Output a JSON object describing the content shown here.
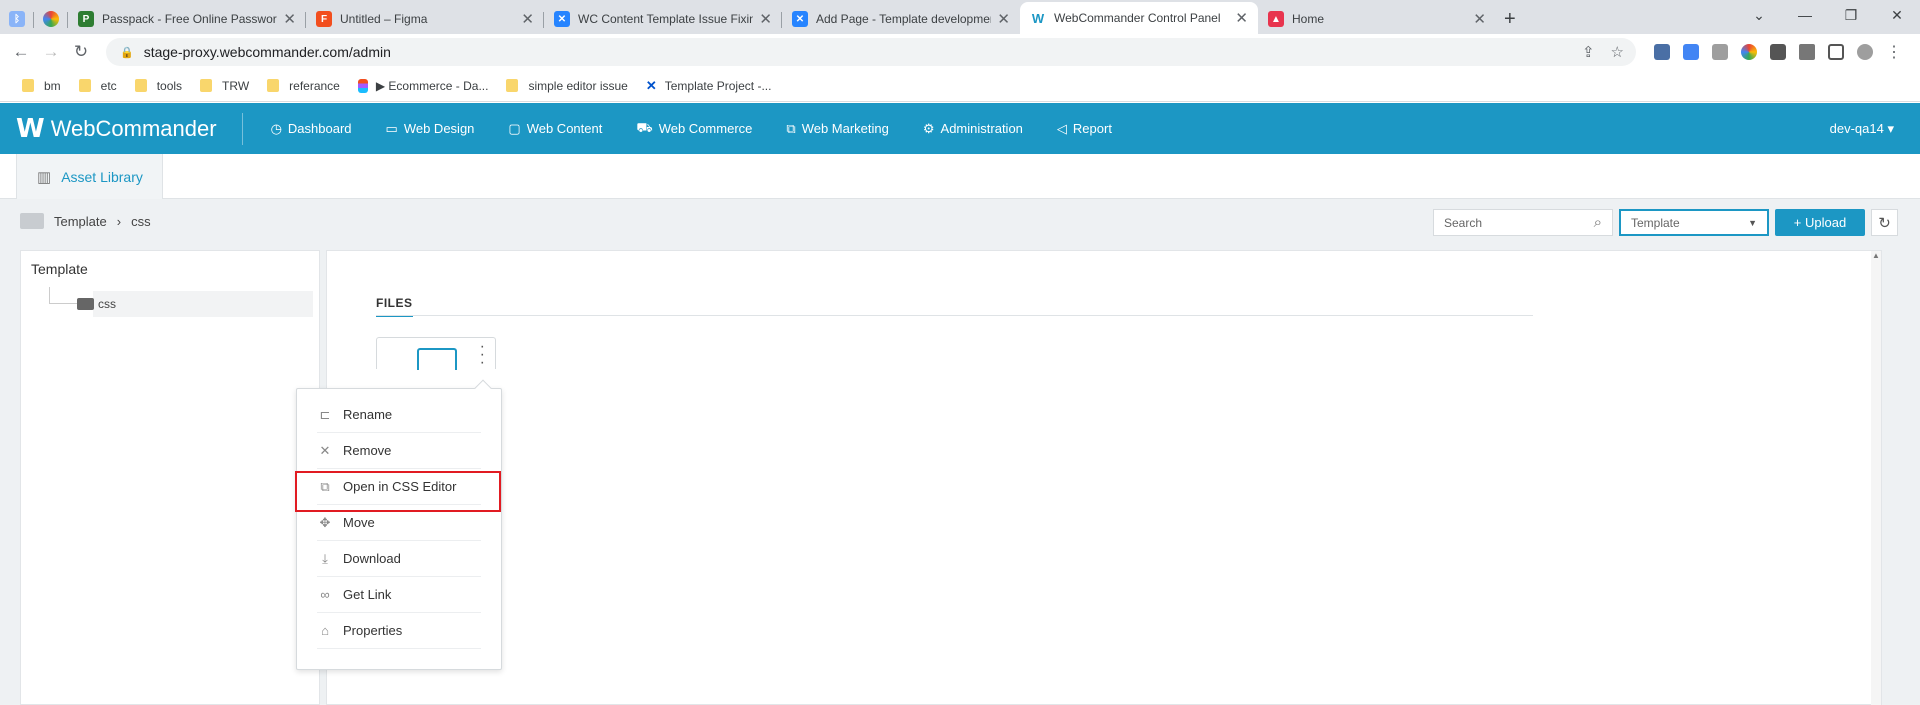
{
  "browser": {
    "tabs": [
      {
        "title": "",
        "favicon": "#8ab4f8",
        "icon": "bluetooth-app-icon"
      },
      {
        "title": "",
        "favicon": "#fbbc04",
        "icon": "colorful-app-icon"
      },
      {
        "title": "Passpack - Free Online Password",
        "favicon": "#2e7d32",
        "icon": "passpack-icon"
      },
      {
        "title": "Untitled – Figma",
        "favicon": "#f24e1e",
        "icon": "figma-icon"
      },
      {
        "title": "WC Content Template Issue Fixing",
        "favicon": "#2684ff",
        "icon": "confluence-icon"
      },
      {
        "title": "Add Page - Template development",
        "favicon": "#2684ff",
        "icon": "confluence-icon"
      },
      {
        "title": "WebCommander Control Panel",
        "favicon": "#1c97c4",
        "icon": "webcommander-icon",
        "active": true
      },
      {
        "title": "Home",
        "favicon": "#e8344e",
        "icon": "home-app-icon"
      }
    ],
    "url": "stage-proxy.webcommander.com/admin",
    "bookmarks": [
      "bm",
      "etc",
      "tools",
      "TRW",
      "referance",
      "▶ Ecommerce - Da...",
      "simple editor issue",
      "Template Project -..."
    ]
  },
  "app": {
    "logo_text": "WebCommander",
    "menu": [
      {
        "label": "Dashboard",
        "icon": "dashboard-icon"
      },
      {
        "label": "Web Design",
        "icon": "monitor-icon"
      },
      {
        "label": "Web Content",
        "icon": "folder-icon"
      },
      {
        "label": "Web Commerce",
        "icon": "cart-icon"
      },
      {
        "label": "Web Marketing",
        "icon": "chart-icon"
      },
      {
        "label": "Administration",
        "icon": "gear-icon"
      },
      {
        "label": "Report",
        "icon": "megaphone-icon"
      }
    ],
    "user": "dev-qa14 ▾",
    "active_tab": "Asset Library",
    "accent": "#1c97c4"
  },
  "content": {
    "breadcrumb": [
      "Template",
      "css"
    ],
    "search_placeholder": "Search",
    "filter_value": "Template",
    "upload_label": "+ Upload",
    "tree_root": "Template",
    "tree_child": "css",
    "files_label": "FILES"
  },
  "context_menu": {
    "items": [
      {
        "label": "Rename",
        "icon": "rename-icon"
      },
      {
        "label": "Remove",
        "icon": "close-icon"
      },
      {
        "label": "Open in CSS Editor",
        "icon": "edit-external-icon",
        "highlighted": true
      },
      {
        "label": "Move",
        "icon": "move-icon"
      },
      {
        "label": "Download",
        "icon": "download-icon"
      },
      {
        "label": "Get Link",
        "icon": "link-icon"
      },
      {
        "label": "Properties",
        "icon": "properties-icon"
      }
    ],
    "highlight_color": "#e11b22"
  }
}
